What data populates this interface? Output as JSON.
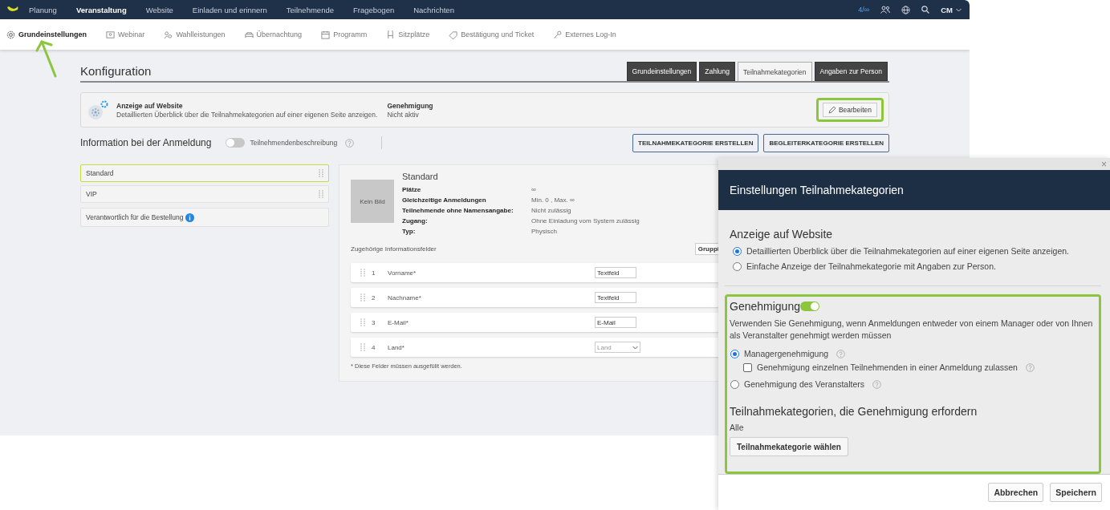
{
  "top_nav": {
    "items": [
      {
        "label": "Planung",
        "selected": false
      },
      {
        "label": "Veranstaltung",
        "selected": true
      },
      {
        "label": "Website",
        "selected": false
      },
      {
        "label": "Einladen und erinnern",
        "selected": false
      },
      {
        "label": "Teilnehmende",
        "selected": false
      },
      {
        "label": "Fragebogen",
        "selected": false
      },
      {
        "label": "Nachrichten",
        "selected": false
      }
    ],
    "counter": "4/∞",
    "user": "CM"
  },
  "sub_nav": {
    "items": [
      {
        "label": "Grundeinstellungen",
        "selected": true
      },
      {
        "label": "Webinar",
        "selected": false
      },
      {
        "label": "Wahlleistungen",
        "selected": false
      },
      {
        "label": "Übernachtung",
        "selected": false
      },
      {
        "label": "Programm",
        "selected": false
      },
      {
        "label": "Sitzplätze",
        "selected": false
      },
      {
        "label": "Bestätigung und Ticket",
        "selected": false
      },
      {
        "label": "Externes Log-In",
        "selected": false
      }
    ]
  },
  "page": {
    "title": "Konfiguration",
    "tabs": [
      {
        "label": "Grundeinstellungen",
        "selected": false
      },
      {
        "label": "Zahlung",
        "selected": false
      },
      {
        "label": "Teilnahmekategorien",
        "selected": true
      },
      {
        "label": "Angaben zur Person",
        "selected": false
      }
    ],
    "summary": {
      "title": "Anzeige auf Website",
      "text": "Detaillierten Überblick über die Teilnahmekategorien auf einer eigenen Seite anzeigen.",
      "approval_title": "Genehmigung",
      "approval_value": "Nicht aktiv",
      "edit_button": "Bearbeiten"
    },
    "info": {
      "title": "Information bei der Anmeldung",
      "toggle_label": "Teilnehmendenbeschreibung",
      "on": false
    },
    "buttons": [
      "TEILNAHMEKATEGORIE ERSTELLEN",
      "BEGLEITERKATEGORIE ERSTELLEN"
    ]
  },
  "categories": [
    {
      "label": "Standard",
      "selected": true
    },
    {
      "label": "VIP",
      "selected": false
    }
  ],
  "responsible": "Verantwortlich für die Bestellung",
  "detail": {
    "image": "Kein Bild",
    "title": "Standard",
    "properties": [
      {
        "label": "Plätze",
        "value": "∞"
      },
      {
        "label": "Gleichzeitige Anmeldungen",
        "value": "Min. 0 , Max. ∞"
      },
      {
        "label": "Teilnehmende ohne Namensangabe:",
        "value": "Nicht zulässig"
      },
      {
        "label": "Zugang:",
        "value": "Ohne Einladung vom System zulässig"
      },
      {
        "label": "Typ:",
        "value": "Physisch"
      }
    ],
    "fields_title": "Zugehörige Informationsfelder",
    "group_button": "Gruppi",
    "fields": [
      {
        "number": "1",
        "label": "Vorname*",
        "kind": "input",
        "type": "Textfeld"
      },
      {
        "number": "2",
        "label": "Nachname*",
        "kind": "input",
        "type": "Textfeld"
      },
      {
        "number": "3",
        "label": "E-Mail*",
        "kind": "input",
        "type": "E-Mail"
      },
      {
        "number": "4",
        "label": "Land*",
        "kind": "select",
        "type": "Land"
      }
    ],
    "footnote": "* Diese Felder müssen ausgefüllt werden."
  },
  "dialog": {
    "close": "×",
    "title": "Einstellungen Teilnahmekategorien",
    "website_heading": "Anzeige auf Website",
    "website_options": [
      {
        "label": "Detaillierten Überblick über die Teilnahmekategorien auf einer eigenen Seite anzeigen.",
        "selected": true
      },
      {
        "label": "Einfache Anzeige der Teilnahmekategorie mit Angaben zur Person.",
        "selected": false
      }
    ],
    "approval_heading": "Genehmigung",
    "approval_on": true,
    "approval_text": "Verwenden Sie Genehmigung, wenn Anmeldungen entweder von einem Manager oder von Ihnen als Veranstalter genehmigt werden müssen",
    "approval_options": [
      {
        "label": "Managergenehmigung",
        "selected": true,
        "sub": {
          "label": "Genehmigung einzelnen Teilnehmenden in einer Anmeldung zulassen",
          "checked": false
        }
      },
      {
        "label": "Genehmigung des Veranstalters",
        "selected": false
      }
    ],
    "categories_heading": "Teilnahmekategorien, die Genehmigung erfordern",
    "categories_value": "Alle",
    "choose_button": "Teilnahmekategorie wählen",
    "buttons": [
      "Abbrechen",
      "Speichern"
    ]
  }
}
